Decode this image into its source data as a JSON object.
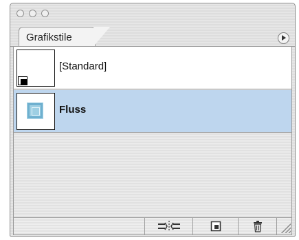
{
  "window": {
    "tab_label": "Grafikstile",
    "traffic_lights": [
      "close",
      "minimize",
      "zoom"
    ]
  },
  "styles_list": [
    {
      "label": "[Standard]",
      "selected": false
    },
    {
      "label": "Fluss",
      "selected": true
    }
  ],
  "bottom_toolbar": {
    "buttons": [
      "break-link-icon",
      "new-style-icon",
      "trash-icon"
    ]
  },
  "colors": {
    "selection": "#bed6ee",
    "fluss_stroke": "#6fb0cf"
  }
}
